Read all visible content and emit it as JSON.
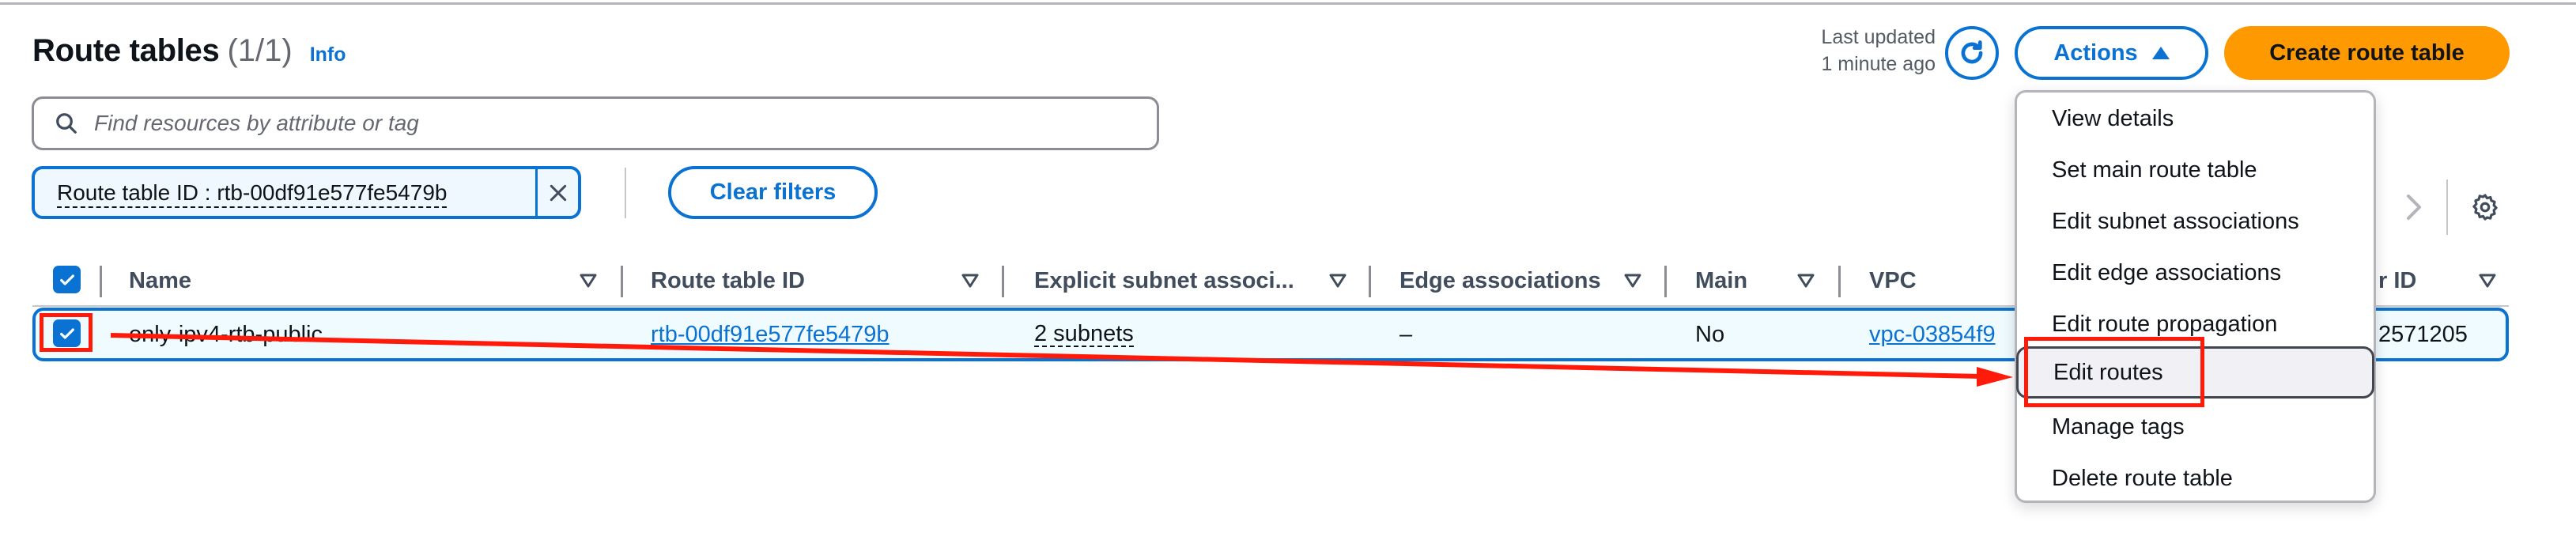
{
  "header": {
    "title": "Route tables",
    "count": "(1/1)",
    "info_link": "Info",
    "last_updated_line1": "Last updated",
    "last_updated_line2": "1 minute ago",
    "refresh_icon": "refresh-icon",
    "actions_label": "Actions",
    "create_label": "Create route table"
  },
  "search": {
    "placeholder": "Find resources by attribute or tag",
    "value": "",
    "icon": "search-icon"
  },
  "filters": {
    "token_label": "Route table ID : rtb-00df91e577fe5479b",
    "clear_label": "Clear filters"
  },
  "table": {
    "select_all_checked": true,
    "columns": [
      {
        "label": "Name"
      },
      {
        "label": "Route table ID"
      },
      {
        "label": "Explicit subnet associ..."
      },
      {
        "label": "Edge associations"
      },
      {
        "label": "Main"
      },
      {
        "label": "VPC"
      },
      {
        "label": "r ID"
      }
    ],
    "rows": [
      {
        "checked": true,
        "name": "only-ipv4-rtb-public",
        "route_table_id": "rtb-00df91e577fe5479b",
        "explicit_subnet_associations": "2 subnets",
        "edge_associations": "–",
        "main": "No",
        "vpc": "vpc-03854f9",
        "owner_id": "2571205"
      }
    ]
  },
  "actions_menu": {
    "open": true,
    "items": [
      {
        "label": "View details"
      },
      {
        "label": "Set main route table"
      },
      {
        "label": "Edit subnet associations"
      },
      {
        "label": "Edit edge associations"
      },
      {
        "label": "Edit route propagation"
      },
      {
        "label": "Edit routes",
        "highlighted": true
      },
      {
        "label": "Manage tags"
      },
      {
        "label": "Delete route table"
      }
    ]
  },
  "colors": {
    "primary": "#0972d3",
    "create_button": "#ff9900",
    "selected_row_bg": "#f0fbff",
    "annotation": "#ff1a0a"
  }
}
